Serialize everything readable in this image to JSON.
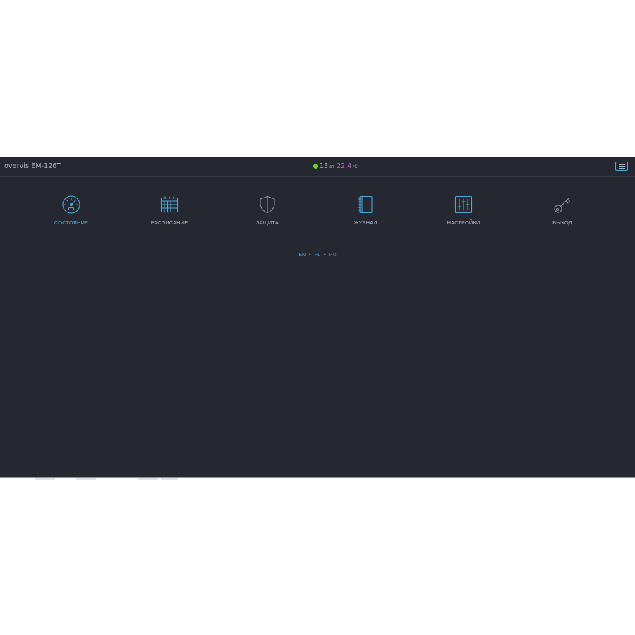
{
  "header": {
    "brand": "overvis EM-126T",
    "status": {
      "online_color": "#6fcf2f",
      "day": "13",
      "weekday": "вт",
      "temperature": "22.4",
      "unit": "°C"
    },
    "menu_icon": "hamburger-menu-icon"
  },
  "nav": {
    "items": [
      {
        "label": "СОСТОЯНИЕ",
        "icon": "speedometer-icon",
        "active": true
      },
      {
        "label": "РАСПИСАНИЕ",
        "icon": "calendar-icon",
        "active": false
      },
      {
        "label": "ЗАЩИТА",
        "icon": "shield-icon",
        "active": false
      },
      {
        "label": "ЖУРНАЛ",
        "icon": "notebook-icon",
        "active": false
      },
      {
        "label": "НАСТРОЙКИ",
        "icon": "sliders-icon",
        "active": false
      },
      {
        "label": "ВЫХОД",
        "icon": "key-icon",
        "active": false
      }
    ]
  },
  "languages": {
    "items": [
      {
        "code": "EN",
        "active": true
      },
      {
        "code": "PL",
        "active": true
      },
      {
        "code": "RU",
        "active": false
      }
    ],
    "separator": "•"
  },
  "colors": {
    "background": "#252831",
    "accent": "#4aa9d6",
    "icon_gray": "#8d939e",
    "text_gray": "#aeb4bf",
    "temperature": "#b865c9"
  }
}
